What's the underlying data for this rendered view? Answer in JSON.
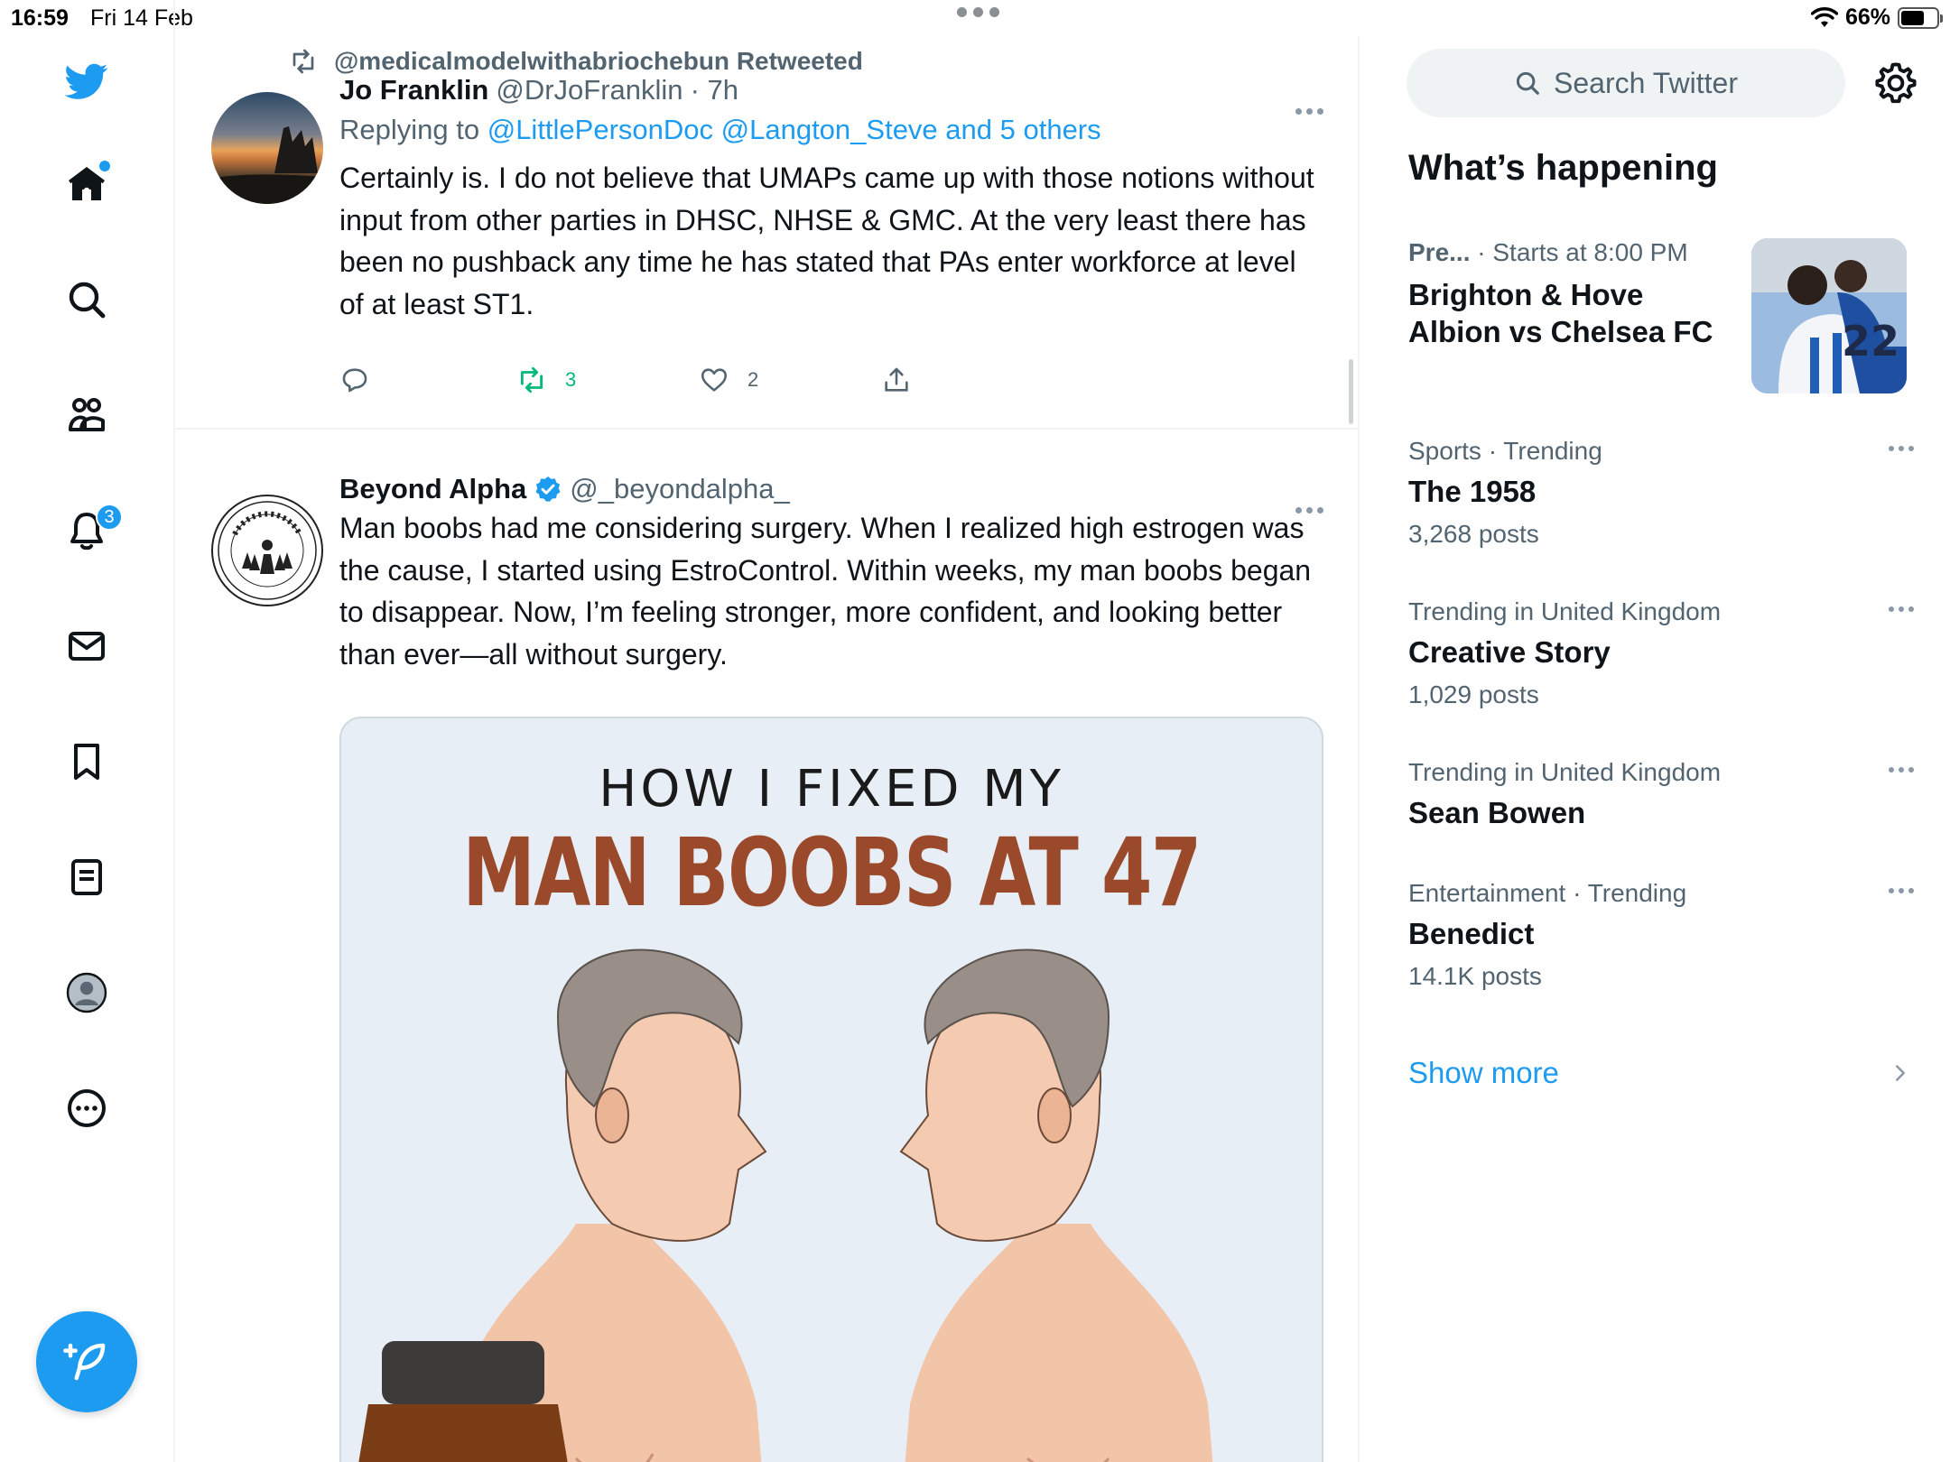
{
  "status_bar": {
    "time": "16:59",
    "date": "Fri 14 Feb",
    "battery": "66%",
    "battery_level": 0.66
  },
  "nav": {
    "notifications_badge": "3",
    "accent": "#1d9bf0"
  },
  "tweets": [
    {
      "retweeted_by": "@medicalmodelwithabriochebun Retweeted",
      "name": "Jo Franklin",
      "handle": "@DrJoFranklin",
      "time": "· 7h",
      "replying_prefix": "Replying to",
      "replying_to": "@LittlePersonDoc @Langton_Steve and 5 others",
      "text": "Certainly is. I do not believe that UMAPs came up with those notions without input from other parties in DHSC, NHSE & GMC. At the very least there has been no pushback any time he has stated that PAs enter workforce at level of at least ST1.",
      "retweets": "3",
      "likes": "2"
    },
    {
      "name": "Beyond Alpha",
      "handle": "@_beyondalpha_",
      "verified": true,
      "text": "Man boobs had me considering surgery. When I realized high estrogen was the cause, I started using EstroControl. Within weeks, my man boobs began to disappear. Now, I’m feeling stronger, more confident, and looking better than ever—all without surgery.",
      "media": {
        "line1": "HOW I FIXED MY",
        "line2": "MAN BOOBS AT 47"
      }
    }
  ],
  "sidebar": {
    "search_placeholder": "Search Twitter",
    "title": "What’s happening",
    "event": {
      "category": "Pre...",
      "time": "· Starts at 8:00 PM",
      "title": "Brighton & Hove Albion vs Chelsea FC"
    },
    "trends": [
      {
        "category": "Sports · Trending",
        "name": "The 1958",
        "count": "3,268 posts"
      },
      {
        "category": "Trending in United Kingdom",
        "name": "Creative Story",
        "count": "1,029 posts"
      },
      {
        "category": "Trending in United Kingdom",
        "name": "Sean Bowen",
        "count": ""
      },
      {
        "category": "Entertainment · Trending",
        "name": "Benedict",
        "count": "14.1K posts"
      }
    ],
    "show_more": "Show more"
  }
}
